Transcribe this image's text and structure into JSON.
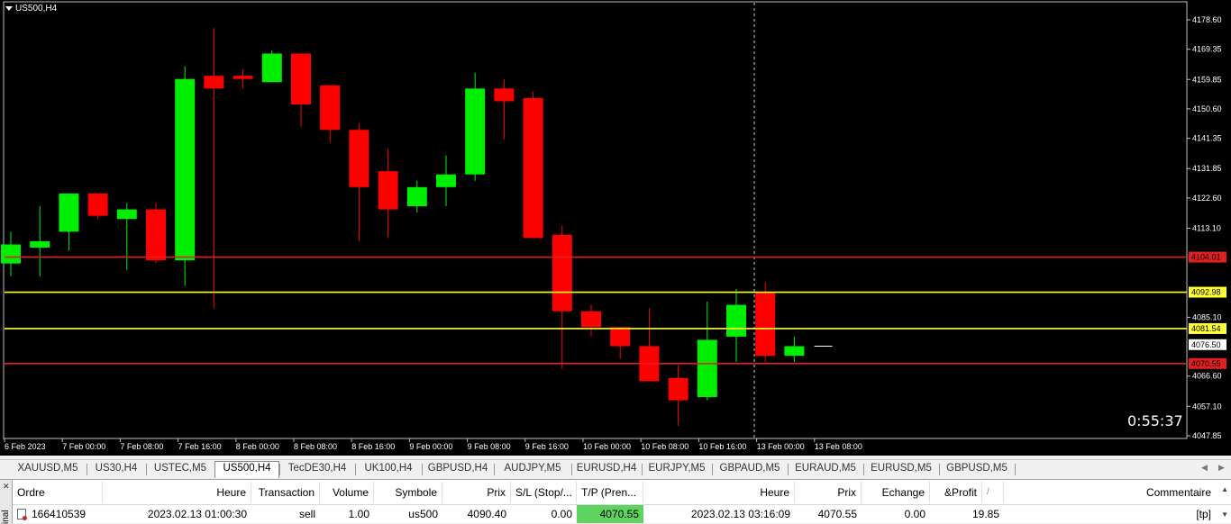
{
  "chart": {
    "symbol": "US500,H4",
    "countdown": "0:55:37",
    "price_axis": [
      "4178.60",
      "4169.35",
      "4159.85",
      "4150.60",
      "4141.35",
      "4131.85",
      "4122.60",
      "4113.10",
      "4085.10",
      "4066.60",
      "4057.10",
      "4047.85"
    ],
    "time_axis": [
      "6 Feb 2023",
      "7 Feb 00:00",
      "7 Feb 08:00",
      "7 Feb 16:00",
      "8 Feb 00:00",
      "8 Feb 08:00",
      "8 Feb 16:00",
      "9 Feb 00:00",
      "9 Feb 08:00",
      "9 Feb 16:00",
      "10 Feb 00:00",
      "10 Feb 08:00",
      "10 Feb 16:00",
      "13 Feb 00:00",
      "13 Feb 08:00"
    ],
    "levels": [
      {
        "label": "4104.01",
        "color": "#e02020"
      },
      {
        "label": "4092.98",
        "color": "#ffff33"
      },
      {
        "label": "4081.54",
        "color": "#ffff33"
      },
      {
        "label": "4076.50",
        "color": "#ffffff"
      },
      {
        "label": "4070.55",
        "color": "#e02020"
      }
    ],
    "bull_color": "#00ee00",
    "bear_color": "#ff0000"
  },
  "chart_data": {
    "type": "candlestick",
    "ylim": [
      4047.85,
      4178.6
    ],
    "candles": [
      {
        "o": 4102,
        "h": 4112,
        "l": 4098,
        "c": 4108
      },
      {
        "o": 4107,
        "h": 4120,
        "l": 4098,
        "c": 4109
      },
      {
        "o": 4112,
        "h": 4124,
        "l": 4106,
        "c": 4124
      },
      {
        "o": 4124,
        "h": 4124,
        "l": 4116,
        "c": 4117
      },
      {
        "o": 4116,
        "h": 4121,
        "l": 4100,
        "c": 4119
      },
      {
        "o": 4119,
        "h": 4121,
        "l": 4102,
        "c": 4103
      },
      {
        "o": 4103,
        "h": 4164,
        "l": 4095,
        "c": 4160
      },
      {
        "o": 4161,
        "h": 4176,
        "l": 4088,
        "c": 4157
      },
      {
        "o": 4161,
        "h": 4163,
        "l": 4157,
        "c": 4160
      },
      {
        "o": 4159,
        "h": 4169,
        "l": 4159,
        "c": 4168
      },
      {
        "o": 4168,
        "h": 4168,
        "l": 4145,
        "c": 4152
      },
      {
        "o": 4158,
        "h": 4158,
        "l": 4140,
        "c": 4144
      },
      {
        "o": 4144,
        "h": 4146,
        "l": 4109,
        "c": 4126
      },
      {
        "o": 4131,
        "h": 4138,
        "l": 4110,
        "c": 4119
      },
      {
        "o": 4120,
        "h": 4128,
        "l": 4118,
        "c": 4126
      },
      {
        "o": 4126,
        "h": 4136,
        "l": 4120,
        "c": 4130
      },
      {
        "o": 4130,
        "h": 4162,
        "l": 4128,
        "c": 4157
      },
      {
        "o": 4157,
        "h": 4160,
        "l": 4141,
        "c": 4153
      },
      {
        "o": 4154,
        "h": 4156,
        "l": 4110,
        "c": 4110
      },
      {
        "o": 4111,
        "h": 4114,
        "l": 4069,
        "c": 4087
      },
      {
        "o": 4087,
        "h": 4089,
        "l": 4079,
        "c": 4082
      },
      {
        "o": 4082,
        "h": 4082,
        "l": 4072,
        "c": 4076
      },
      {
        "o": 4076,
        "h": 4088,
        "l": 4065,
        "c": 4065
      },
      {
        "o": 4066,
        "h": 4070,
        "l": 4051,
        "c": 4059
      },
      {
        "o": 4060,
        "h": 4090,
        "l": 4059,
        "c": 4078
      },
      {
        "o": 4079,
        "h": 4094,
        "l": 4071,
        "c": 4089
      },
      {
        "o": 4093,
        "h": 4096,
        "l": 4071,
        "c": 4073
      },
      {
        "o": 4073,
        "h": 4079,
        "l": 4071,
        "c": 4076
      },
      {
        "o": 4076,
        "h": 4077,
        "l": 4075,
        "c": 4076
      }
    ]
  },
  "tabs": {
    "items": [
      "XAUUSD,M5",
      "US30,H4",
      "USTEC,M5",
      "US500,H4",
      "TecDE30,H4",
      "UK100,H4",
      "GBPUSD,H4",
      "AUDJPY,M5",
      "EURUSD,H4",
      "EURJPY,M5",
      "GBPAUD,M5",
      "EURAUD,M5",
      "EURUSD,M5",
      "GBPUSD,M5"
    ],
    "active_index": 3
  },
  "terminal": {
    "side_label": "inal",
    "headers": [
      "Ordre",
      "Heure",
      "Transaction",
      "Volume",
      "Symbole",
      "Prix",
      "S/L (Stop/...",
      "T/P (Pren...",
      "Heure",
      "Prix",
      "Echange",
      "&Profit",
      "/",
      "Commentaire"
    ],
    "row": {
      "ordre": "166410539",
      "heure": "2023.02.13 01:00:30",
      "transaction": "sell",
      "volume": "1.00",
      "symbole": "us500",
      "prix": "4090.40",
      "sl": "0.00",
      "tp": "4070.55",
      "heure_close": "2023.02.13 03:16:09",
      "prix_close": "4070.55",
      "echange": "0.00",
      "profit": "19.85",
      "commentaire": "[tp]"
    }
  }
}
